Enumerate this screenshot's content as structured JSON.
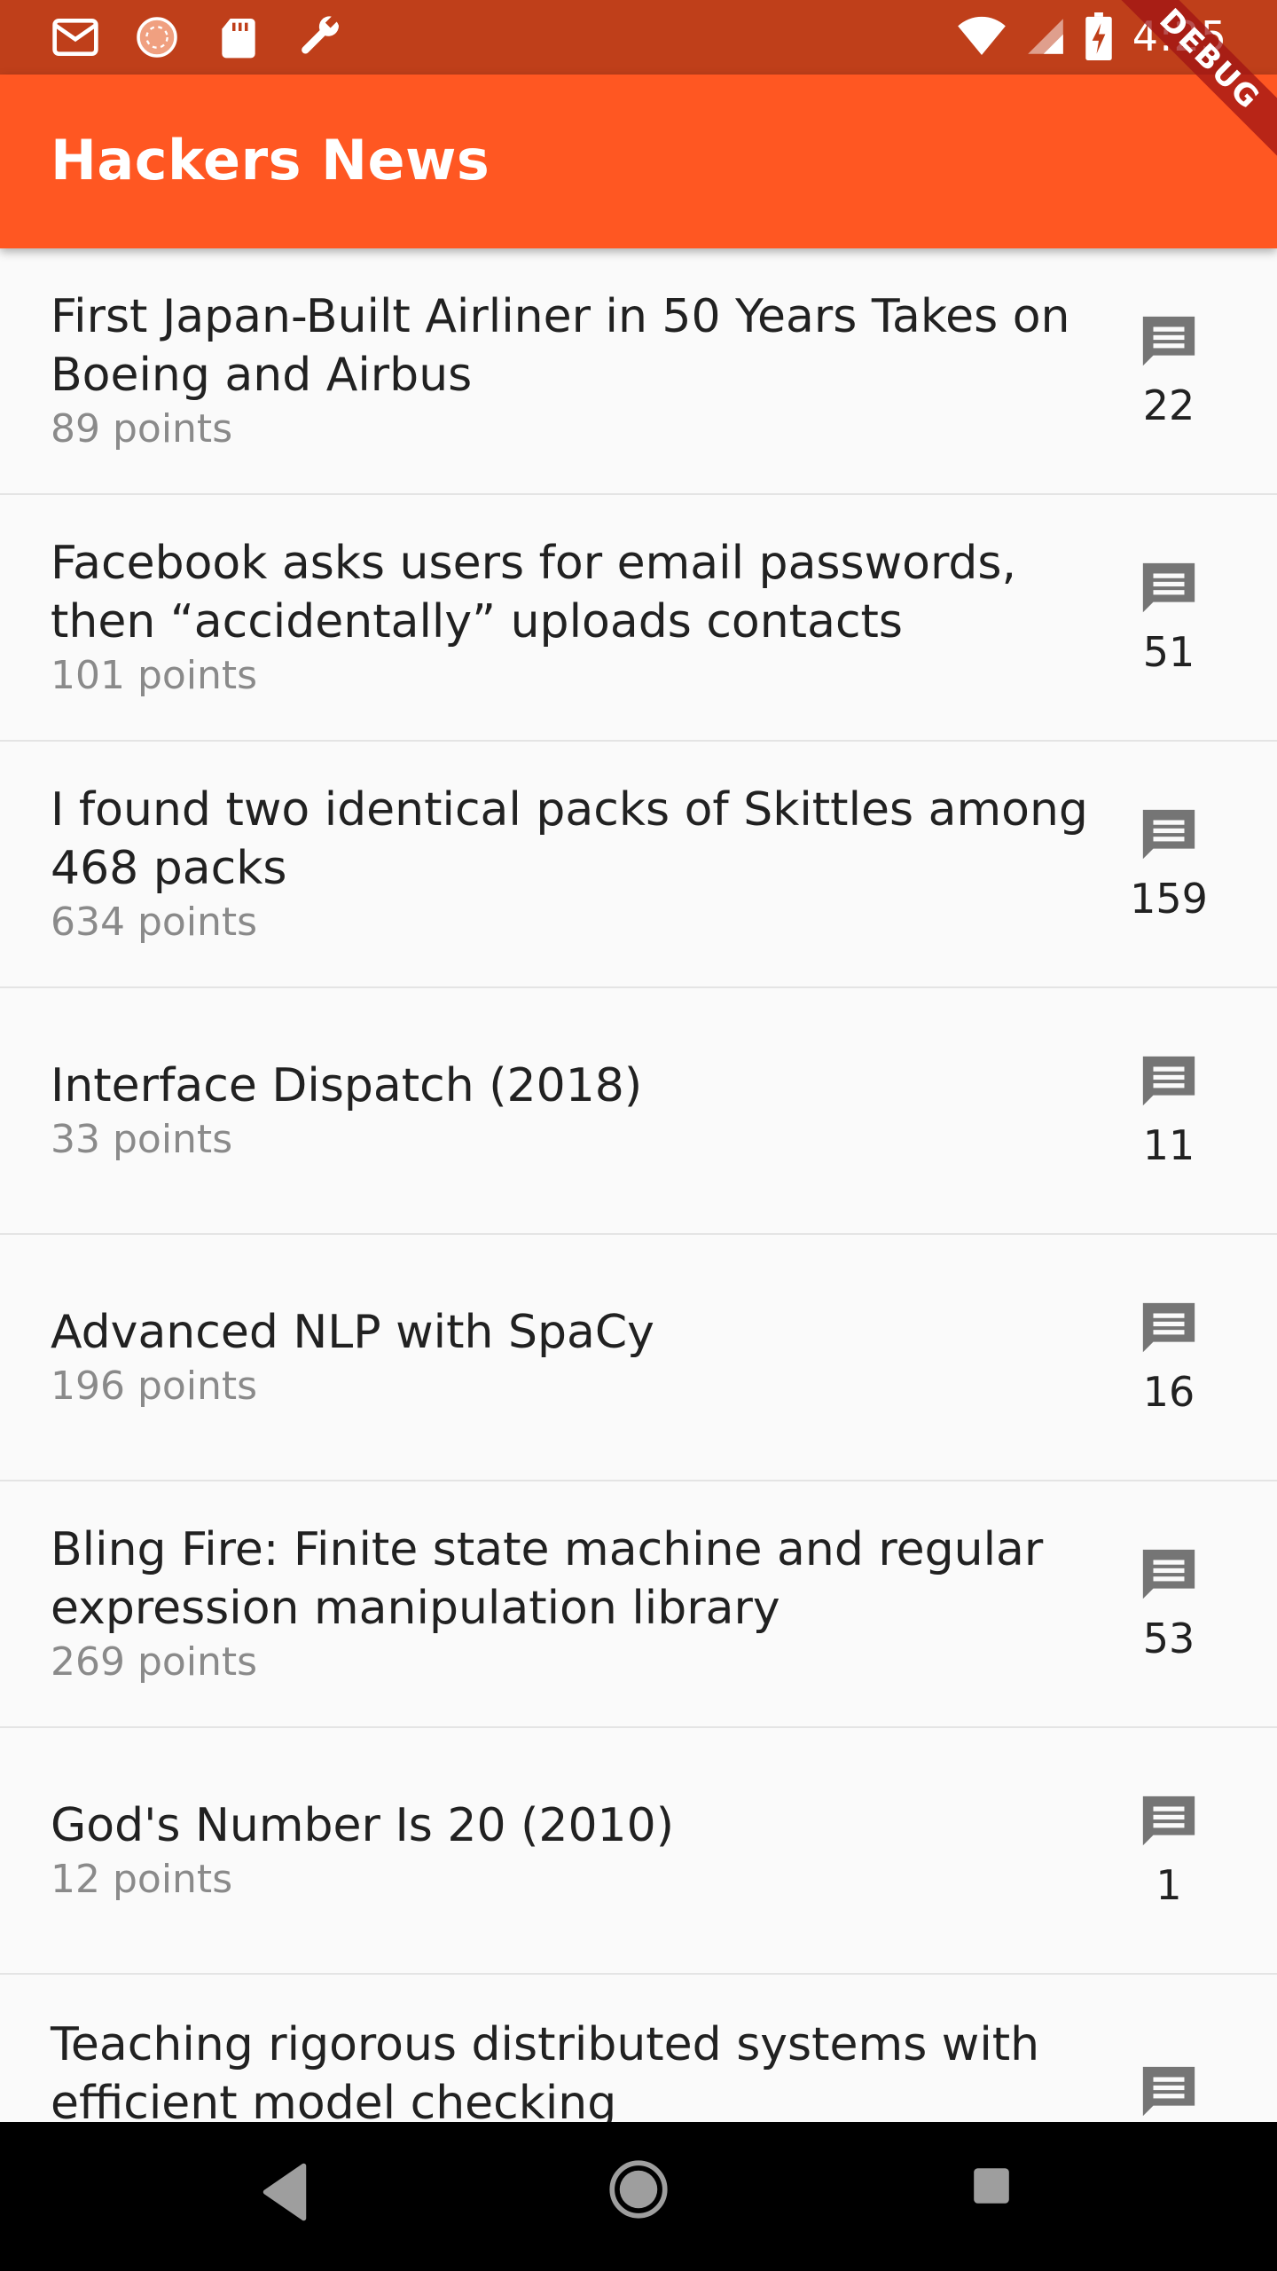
{
  "status_bar": {
    "time": "4:25",
    "left_icons": [
      "gmail-icon",
      "sync-icon",
      "sd-card-icon",
      "wrench-icon"
    ],
    "right_icons": [
      "wifi-icon",
      "signal-icon",
      "battery-charging-icon"
    ],
    "background": "#bf3f1a"
  },
  "app_bar": {
    "title": "Hackers News",
    "background": "#ff5722",
    "debug_ribbon": "DEBUG"
  },
  "stories": [
    {
      "title": "First Japan-Built Airliner in 50 Years Takes on Boeing and Airbus",
      "points": "89 points",
      "comments": "22"
    },
    {
      "title": "Facebook asks users for email passwords, then “accidentally” uploads contacts",
      "points": "101 points",
      "comments": "51"
    },
    {
      "title": "I found two identical packs of Skittles among 468 packs",
      "points": "634 points",
      "comments": "159"
    },
    {
      "title": "Interface Dispatch (2018)",
      "points": "33 points",
      "comments": "11"
    },
    {
      "title": "Advanced NLP with SpaCy",
      "points": "196 points",
      "comments": "16"
    },
    {
      "title": "Bling Fire: Finite state machine and regular expression manipulation library",
      "points": "269 points",
      "comments": "53"
    },
    {
      "title": "God's Number Is 20 (2010)",
      "points": "12 points",
      "comments": "1"
    },
    {
      "title": "Teaching rigorous distributed systems with efficient model checking",
      "points": "",
      "comments": ""
    }
  ],
  "nav_bar": {
    "buttons": [
      "back-icon",
      "home-icon",
      "recents-icon"
    ]
  }
}
